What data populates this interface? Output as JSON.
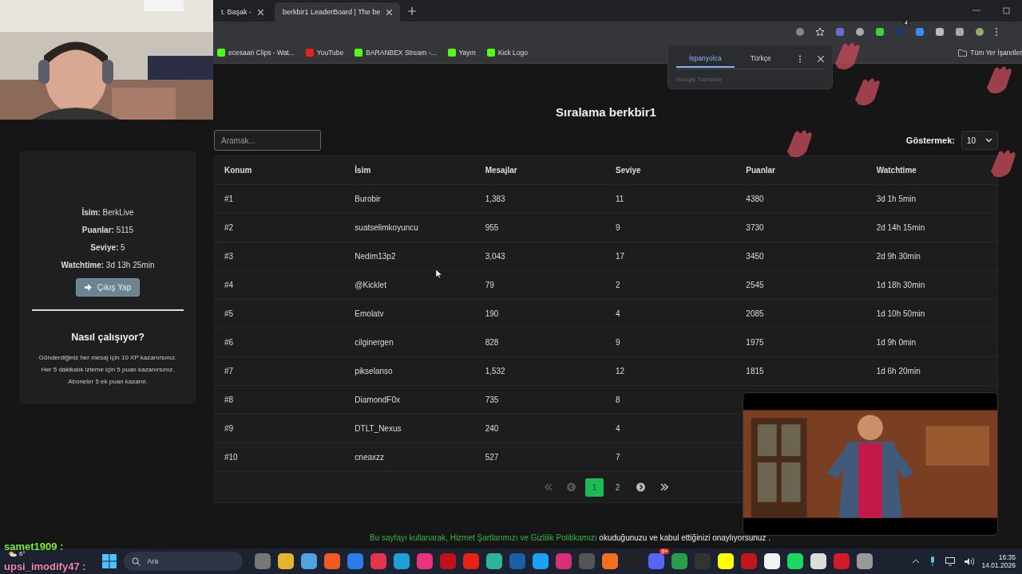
{
  "browser": {
    "tabs": [
      {
        "label": "t. Başak -",
        "selected": false
      },
      {
        "label": "berkbir1 LeaderBoard | The be",
        "selected": true
      }
    ],
    "extension_badge": "4",
    "bookmarks": [
      "ecesaari Clips - Wat...",
      "YouTube",
      "BARANBEX Stream -...",
      "Yayın",
      "Kick Logo"
    ],
    "all_bookmarks": "Tüm Yer İşaretler"
  },
  "translate_popup": {
    "languages": [
      {
        "label": "İspanyolca",
        "selected": true
      },
      {
        "label": "Türkçe",
        "selected": false
      }
    ],
    "footer": "Google Translate"
  },
  "profile": {
    "fields": [
      "**İsim:** BerkLive",
      "**Puanlar:** 5115",
      "**Seviye:** 5",
      "**Watchtime:** 3d 13h 25min"
    ],
    "logout": "Çıkış Yap",
    "help_title": "Nasıl çalışıyor?",
    "help_lines": [
      "Gönderdiğiniz her mesaj için 10 XP kazanırsınız.",
      "Her 5 dakikalık izleme için 5 puan kazanırsınız.",
      "Aboneler 5 ek puan kazanır."
    ]
  },
  "leaderboard": {
    "title": "Sıralama berkbir1",
    "search": {
      "placeholder": "Aramak..."
    },
    "show_label": "Göstermek:",
    "show_value": "10",
    "columns": [
      "Konum",
      "İsim",
      "Mesajlar",
      "Seviye",
      "Puanlar",
      "Watchtime"
    ],
    "rows": [
      {
        "rank": "#1",
        "name": "Burobir",
        "messages": "1,383",
        "level": "11",
        "points": "4380",
        "watchtime": "3d 1h 5min"
      },
      {
        "rank": "#2",
        "name": "suatselimkoyuncu",
        "messages": "955",
        "level": "9",
        "points": "3730",
        "watchtime": "2d 14h 15min"
      },
      {
        "rank": "#3",
        "name": "Nedim13p2",
        "messages": "3,043",
        "level": "17",
        "points": "3450",
        "watchtime": "2d 9h 30min"
      },
      {
        "rank": "#4",
        "name": "@Kicklet",
        "messages": "79",
        "level": "2",
        "points": "2545",
        "watchtime": "1d 18h 30min"
      },
      {
        "rank": "#5",
        "name": "Emolatv",
        "messages": "190",
        "level": "4",
        "points": "2085",
        "watchtime": "1d 10h 50min"
      },
      {
        "rank": "#6",
        "name": "cilginergen",
        "messages": "828",
        "level": "9",
        "points": "1975",
        "watchtime": "1d 9h 0min"
      },
      {
        "rank": "#7",
        "name": "pikselanso",
        "messages": "1,532",
        "level": "12",
        "points": "1815",
        "watchtime": "1d 6h 20min"
      },
      {
        "rank": "#8",
        "name": "DiamondF0x",
        "messages": "735",
        "level": "8"
      },
      {
        "rank": "#9",
        "name": "DTLT_Nexus",
        "messages": "240",
        "level": "4"
      },
      {
        "rank": "#10",
        "name": "cneaxzz",
        "messages": "527",
        "level": "7"
      }
    ],
    "pagination": [
      {
        "kind": "first",
        "disabled": true
      },
      {
        "kind": "prev",
        "disabled": true
      },
      {
        "kind": "page",
        "label": "1",
        "selected": true
      },
      {
        "kind": "page",
        "label": "2",
        "selected": false
      },
      {
        "kind": "next",
        "disabled": false
      },
      {
        "kind": "last",
        "disabled": false
      }
    ]
  },
  "footer": [
    {
      "text": "Bu sayfayı kullanarak, ",
      "kind": "accent"
    },
    {
      "text": "Hizmet Şartlarımızı",
      "kind": "link"
    },
    {
      "text": " ve ",
      "kind": "accent"
    },
    {
      "text": "Gizlilik Politikamızı",
      "kind": "link"
    },
    {
      "text": " okuduğunuzu ve kabul ettiğinizi onaylıyorsunuz .",
      "kind": "text"
    }
  ],
  "chat_overlay": [
    {
      "user": "samet1909 :",
      "color": "#7cf03c"
    },
    {
      "user": "upsi_imodify47 :",
      "color": "#f28bb0"
    }
  ],
  "taskbar": {
    "weather": "6°",
    "search_placeholder": "Ara",
    "discord_badge": "9+",
    "time": "16:35",
    "date": "14.01.2026"
  }
}
